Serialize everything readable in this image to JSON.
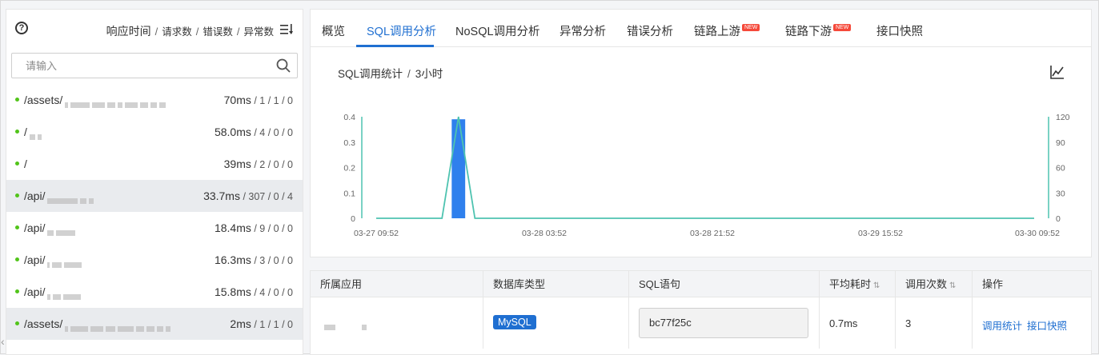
{
  "left_panel": {
    "metrics": {
      "primary": "响应时间",
      "second": "请求数",
      "third": "错误数",
      "fourth": "异常数",
      "separator": "/"
    },
    "search": {
      "placeholder": "请输入",
      "value": ""
    },
    "items": [
      {
        "path": "/assets/",
        "time": "70ms",
        "counts": " / 1 / 1 / 0",
        "selected": false
      },
      {
        "path": "/",
        "time": "58.0ms",
        "counts": " / 4 / 0 / 0",
        "selected": false
      },
      {
        "path": "/",
        "time": "39ms",
        "counts": " / 2 / 0 / 0",
        "selected": false
      },
      {
        "path": "/api/",
        "time": "33.7ms",
        "counts": " / 307 / 0 / 4",
        "selected": true
      },
      {
        "path": "/api/",
        "time": "18.4ms",
        "counts": " / 9 / 0 / 0",
        "selected": false
      },
      {
        "path": "/api/",
        "time": "16.3ms",
        "counts": " / 3 / 0 / 0",
        "selected": false
      },
      {
        "path": "/api/",
        "time": "15.8ms",
        "counts": " / 4 / 0 / 0",
        "selected": false
      },
      {
        "path": "/assets/",
        "time": "2ms",
        "counts": " / 1 / 1 / 0",
        "selected": true
      }
    ]
  },
  "tabs": [
    {
      "label": "概览",
      "active": false,
      "badge": ""
    },
    {
      "label": "SQL调用分析",
      "active": true,
      "badge": ""
    },
    {
      "label": "NoSQL调用分析",
      "active": false,
      "badge": ""
    },
    {
      "label": "异常分析",
      "active": false,
      "badge": ""
    },
    {
      "label": "错误分析",
      "active": false,
      "badge": ""
    },
    {
      "label": "链路上游",
      "active": false,
      "badge": "NEW"
    },
    {
      "label": "链路下游",
      "active": false,
      "badge": "NEW"
    },
    {
      "label": "接口快照",
      "active": false,
      "badge": ""
    }
  ],
  "chart_header": {
    "title": "SQL调用统计",
    "separator": "/",
    "range": "3小时"
  },
  "chart_data": {
    "type": "bar",
    "title": "SQL调用统计",
    "x_tick_labels": [
      "03-27 09:52",
      "03-28 03:52",
      "03-28 21:52",
      "03-29 15:52",
      "03-30 09:52"
    ],
    "left_axis": {
      "ticks": [
        "0",
        "0.1",
        "0.2",
        "0.3",
        "0.4"
      ],
      "ylim": [
        0,
        0.4
      ]
    },
    "right_axis": {
      "ticks": [
        "0",
        "30",
        "60",
        "90",
        "120"
      ],
      "ylim": [
        0,
        120
      ]
    },
    "bar_series": {
      "values": [
        0,
        0,
        0,
        0,
        0,
        0.39,
        0,
        0,
        0,
        0,
        0,
        0,
        0,
        0,
        0,
        0,
        0,
        0,
        0,
        0,
        0,
        0,
        0,
        0,
        0,
        0,
        0,
        0,
        0,
        0,
        0,
        0,
        0,
        0,
        0,
        0,
        0,
        0,
        0,
        0,
        0
      ],
      "color": "#2f80ed"
    },
    "line_series": {
      "values": [
        0,
        0,
        0,
        0,
        0,
        120,
        0,
        0,
        0,
        0,
        0,
        0,
        0,
        0,
        0,
        0,
        0,
        0,
        0,
        0,
        0,
        0,
        0,
        0,
        0,
        0,
        0,
        0,
        0,
        0,
        0,
        0,
        0,
        0,
        0,
        0,
        0,
        0,
        0,
        0,
        0
      ],
      "color": "#4ec3b0"
    },
    "grid": false
  },
  "table": {
    "headers": [
      "所属应用",
      "数据库类型",
      "SQL语句",
      "平均耗时",
      "调用次数",
      "操作"
    ],
    "row": {
      "app": "",
      "db_type": "MySQL",
      "sql": "bc77f25c",
      "avg_time": "0.7ms",
      "calls": "3",
      "actions": [
        "调用统计",
        "接口快照"
      ]
    }
  },
  "colors": {
    "accent": "#1f6fd1",
    "status_ok": "#52c41a",
    "badge_new": "#f5493a"
  }
}
